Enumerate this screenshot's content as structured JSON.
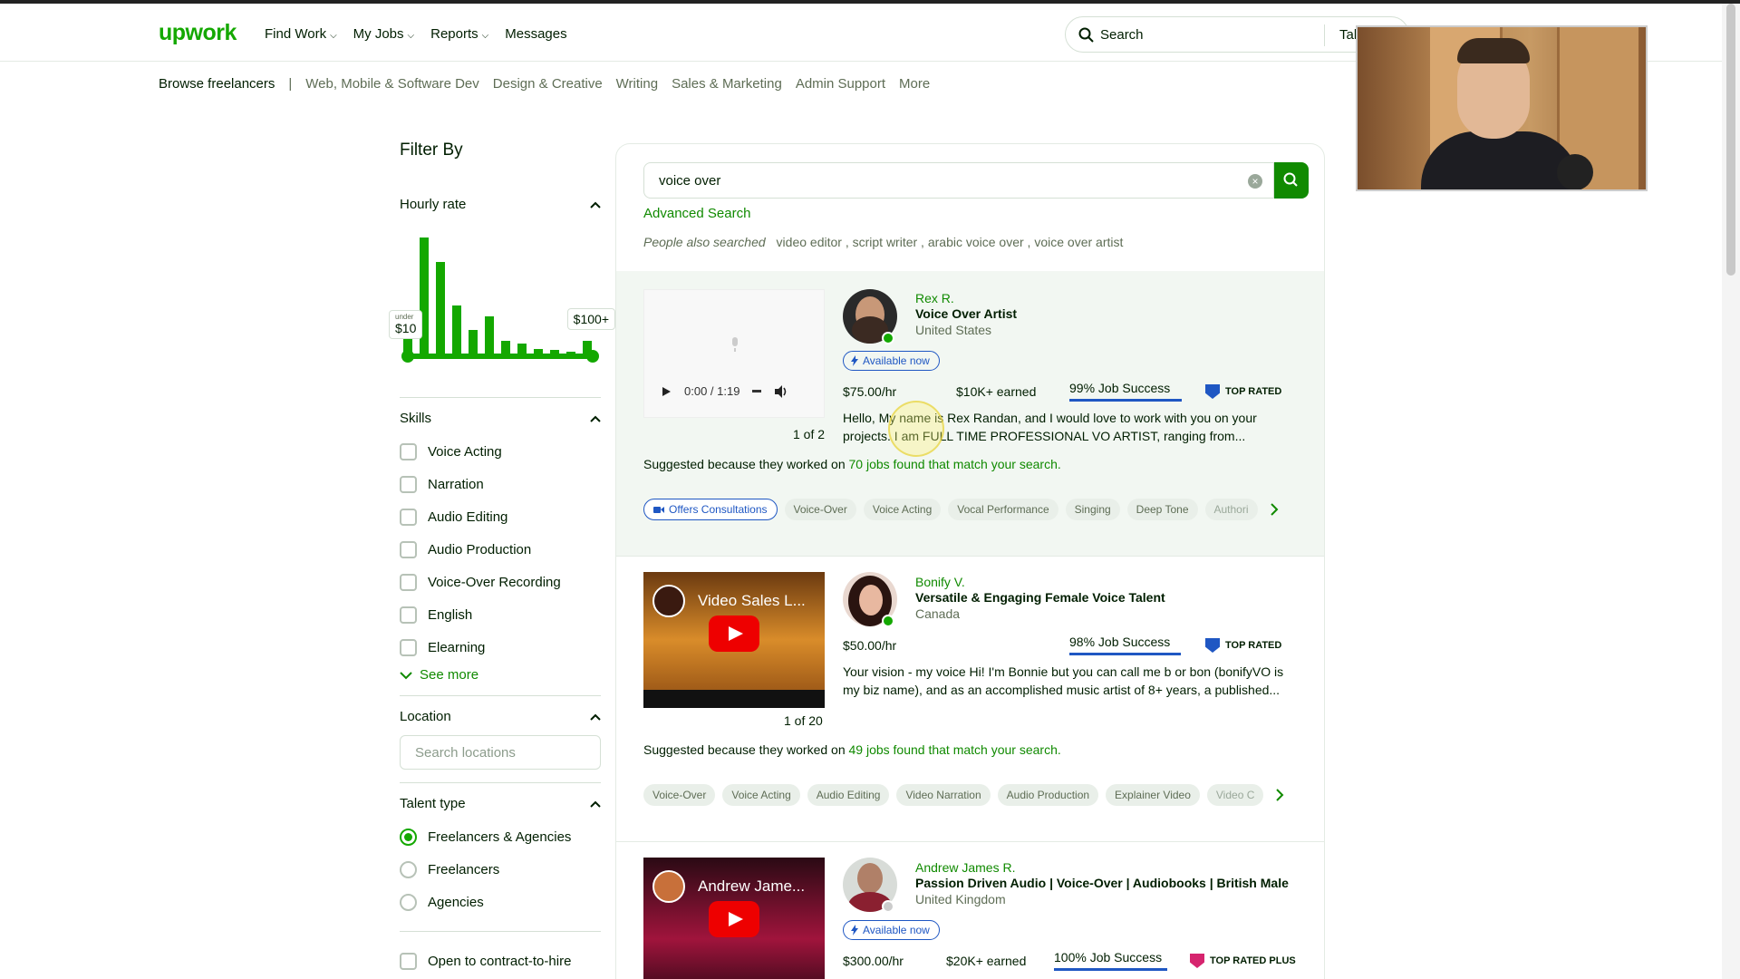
{
  "header": {
    "logo": "upwork",
    "nav": [
      "Find Work",
      "My Jobs",
      "Reports",
      "Messages"
    ],
    "search_placeholder": "Search",
    "search_scope": "Tal"
  },
  "catnav": {
    "browse": "Browse freelancers",
    "sep": "|",
    "items": [
      "Web, Mobile & Software Dev",
      "Design & Creative",
      "Writing",
      "Sales & Marketing",
      "Admin Support",
      "More"
    ]
  },
  "filter": {
    "title": "Filter By",
    "hourly_rate": {
      "title": "Hourly rate",
      "min_prefix": "under",
      "min_label": "$10",
      "max_label": "$100+",
      "histogram": [
        0.22,
        0.88,
        0.7,
        0.38,
        0.2,
        0.3,
        0.12,
        0.1,
        0.06,
        0.05,
        0.04,
        0.12
      ]
    },
    "skills": {
      "title": "Skills",
      "items": [
        "Voice Acting",
        "Narration",
        "Audio Editing",
        "Audio Production",
        "Voice-Over Recording",
        "English",
        "Elearning"
      ],
      "see_more": "See more"
    },
    "location": {
      "title": "Location",
      "placeholder": "Search locations"
    },
    "talent_type": {
      "title": "Talent type",
      "options": [
        "Freelancers & Agencies",
        "Freelancers",
        "Agencies"
      ],
      "selected": "Freelancers & Agencies"
    },
    "contract_to_hire": "Open to contract-to-hire"
  },
  "results": {
    "query": "voice over",
    "advanced": "Advanced Search",
    "also_label": "People also searched",
    "also": [
      "video editor ,",
      "script writer ,",
      "arabic voice over ,",
      "voice over artist"
    ],
    "cards": [
      {
        "name": "Rex R.",
        "title": "Voice Over Artist",
        "country": "United States",
        "available": "Available now",
        "rate": "$75.00/hr",
        "earned": "$10K+ earned",
        "jss": "99% Job Success",
        "jss_value": 99,
        "badge": "TOP RATED",
        "media_time": "0:00 / 1:19",
        "counter": "1 of 2",
        "desc1": "Hello, My name is Rex Randan, and I would love to work with you on your",
        "desc2": "projects. I am FULL TIME PROFESSIONAL VO ARTIST, ranging from...",
        "sugg_pre": "Suggested because they worked on",
        "sugg_link": "70 jobs found that match your search.",
        "tags": [
          "Offers Consultations",
          "Voice-Over",
          "Voice Acting",
          "Vocal Performance",
          "Singing",
          "Deep Tone",
          "Authori"
        ]
      },
      {
        "name": "Bonify V.",
        "title": "Versatile & Engaging Female Voice Talent",
        "country": "Canada",
        "rate": "$50.00/hr",
        "jss": "98% Job Success",
        "jss_value": 98,
        "badge": "TOP RATED",
        "video_title": "Video Sales L...",
        "counter": "1 of 20",
        "desc1": "Your vision - my voice Hi! I'm Bonnie but you can call me b or bon (bonifyVO is",
        "desc2": "my biz name), and as an accomplished music artist of 8+ years, a published...",
        "sugg_pre": "Suggested because they worked on",
        "sugg_link": "49 jobs found that match your search.",
        "tags": [
          "Voice-Over",
          "Voice Acting",
          "Audio Editing",
          "Video Narration",
          "Audio Production",
          "Explainer Video",
          "Video C"
        ]
      },
      {
        "name": "Andrew James R.",
        "title": "Passion Driven Audio | Voice-Over | Audiobooks | British Male",
        "country": "United Kingdom",
        "available": "Available now",
        "rate": "$300.00/hr",
        "earned": "$20K+ earned",
        "jss": "100% Job Success",
        "jss_value": 100,
        "badge": "TOP RATED PLUS",
        "video_title": "Andrew Jame..."
      }
    ]
  },
  "colors": {
    "brand": "#14a800",
    "link": "#108a00",
    "badge_blue": "#1f57c3",
    "badge_plus": "#d6246e"
  }
}
